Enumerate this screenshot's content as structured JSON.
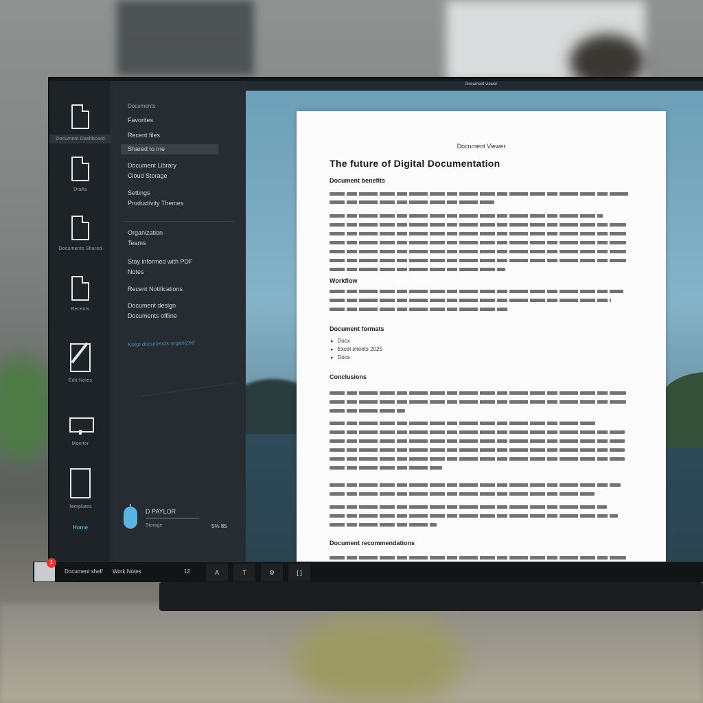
{
  "rail": {
    "items": [
      {
        "label": "Document Dashboard"
      },
      {
        "label": "Drafts"
      },
      {
        "label": "Documents Shared"
      },
      {
        "label": "Recents"
      },
      {
        "label": "Edit Notes"
      },
      {
        "label": "Monitor"
      },
      {
        "label": "Templates"
      }
    ],
    "link": "Home"
  },
  "panel": {
    "heading": "Documents",
    "rows": [
      {
        "text": "Favorites"
      },
      {
        "text": "Recent files"
      },
      {
        "text": "Shared to me"
      },
      {
        "text": "Document Library",
        "sub": "Cloud Storage"
      },
      {
        "text": "Settings",
        "sub": "Productivity Themes"
      },
      {
        "text": "Organization",
        "sub": "Teams"
      },
      {
        "text": "Stay informed with PDF",
        "sub": "Notes"
      },
      {
        "text": "Recent Notifications"
      },
      {
        "text": "Document design",
        "sub": "Documents offline"
      }
    ],
    "tagline": "Keep documents organized",
    "user": {
      "name": "D PAYLOR",
      "sub": "Storage",
      "value": "5% 85"
    }
  },
  "topbar": {
    "text": "Document viewer"
  },
  "document": {
    "label": "Document Viewer",
    "title": "The future of Digital Documentation",
    "headings": [
      "Document benefits",
      "Workflow",
      "Document formats",
      "Conclusions",
      "Document recommendations"
    ],
    "bullets": [
      "Docx",
      "Excel sheets 2025",
      "Docs"
    ]
  },
  "taskbar": {
    "items": [
      "Document shelf",
      "Work Notes",
      "12"
    ],
    "buttons": [
      "A",
      "T",
      "⚙",
      "[ ]"
    ],
    "badge": "1"
  },
  "colors": {
    "accent": "#4aa8d8",
    "badge": "#e53935"
  }
}
